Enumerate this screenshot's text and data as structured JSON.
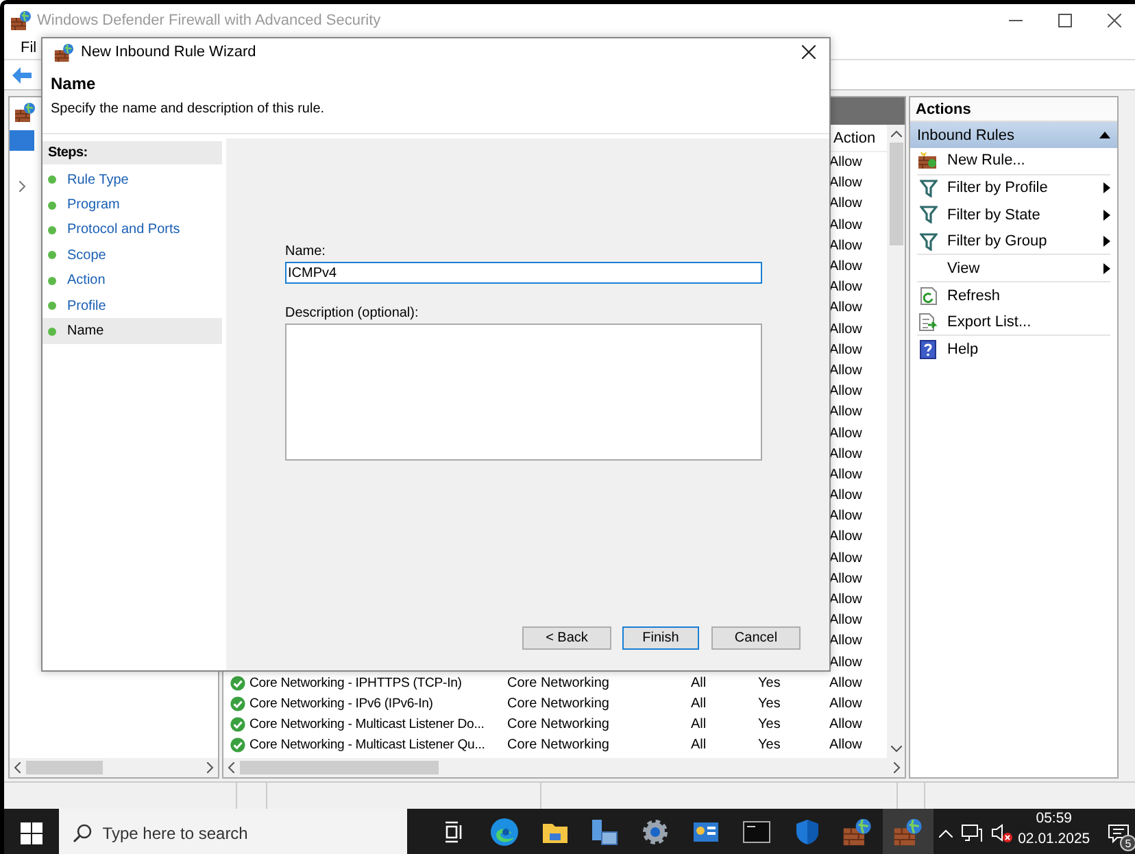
{
  "main_window": {
    "title": "Windows Defender Firewall with Advanced Security",
    "menu": [
      "Fil"
    ]
  },
  "rules": {
    "columns": [
      {
        "label": "Action"
      }
    ],
    "rows": [
      {
        "action": "Allow"
      },
      {
        "action": "Allow"
      },
      {
        "action": "Allow"
      },
      {
        "action": "Allow"
      },
      {
        "action": "Allow"
      },
      {
        "action": "Allow"
      },
      {
        "action": "Allow"
      },
      {
        "action": "Allow"
      },
      {
        "action": "Allow"
      },
      {
        "action": "Allow"
      },
      {
        "action": "Allow"
      },
      {
        "action": "Allow"
      },
      {
        "action": "Allow"
      },
      {
        "action": "Allow"
      },
      {
        "action": "Allow"
      },
      {
        "action": "Allow"
      },
      {
        "action": "Allow"
      },
      {
        "action": "Allow"
      },
      {
        "action": "Allow"
      },
      {
        "action": "Allow"
      },
      {
        "action": "Allow"
      },
      {
        "action": "Allow"
      },
      {
        "action": "Allow"
      },
      {
        "action": "Allow"
      },
      {
        "action": "Allow"
      },
      {
        "name": "Core Networking - IPHTTPS (TCP-In)",
        "group": "Core Networking",
        "profile": "All",
        "enabled": "Yes",
        "action": "Allow"
      },
      {
        "name": "Core Networking - IPv6 (IPv6-In)",
        "group": "Core Networking",
        "profile": "All",
        "enabled": "Yes",
        "action": "Allow"
      },
      {
        "name": "Core Networking - Multicast Listener Do...",
        "group": "Core Networking",
        "profile": "All",
        "enabled": "Yes",
        "action": "Allow"
      },
      {
        "name": "Core Networking - Multicast Listener Qu...",
        "group": "Core Networking",
        "profile": "All",
        "enabled": "Yes",
        "action": "Allow"
      }
    ]
  },
  "actions_pane": {
    "title": "Actions",
    "section": {
      "label": "Inbound Rules",
      "expanded": true
    },
    "items": [
      {
        "label": "New Rule...",
        "kind": "new_rule",
        "submenu": false,
        "separator": true
      },
      {
        "label": "Filter by Profile",
        "kind": "filter",
        "submenu": true,
        "separator": false
      },
      {
        "label": "Filter by State",
        "kind": "filter",
        "submenu": true,
        "separator": false
      },
      {
        "label": "Filter by Group",
        "kind": "filter",
        "submenu": true,
        "separator": true
      },
      {
        "label": "View",
        "kind": "none",
        "submenu": true,
        "separator": true
      },
      {
        "label": "Refresh",
        "kind": "refresh",
        "submenu": false,
        "separator": false
      },
      {
        "label": "Export List...",
        "kind": "export",
        "submenu": false,
        "separator": true
      },
      {
        "label": "Help",
        "kind": "help",
        "submenu": false,
        "separator": false
      }
    ]
  },
  "wizard": {
    "title": "New Inbound Rule Wizard",
    "heading": "Name",
    "subtitle": "Specify the name and description of this rule.",
    "steps_title": "Steps:",
    "steps": [
      {
        "label": "Rule Type",
        "selected": false
      },
      {
        "label": "Program",
        "selected": false
      },
      {
        "label": "Protocol and Ports",
        "selected": false
      },
      {
        "label": "Scope",
        "selected": false
      },
      {
        "label": "Action",
        "selected": false
      },
      {
        "label": "Profile",
        "selected": false
      },
      {
        "label": "Name",
        "selected": true
      }
    ],
    "name_label": "Name:",
    "name_value": "ICMPv4",
    "description_label": "Description (optional):",
    "buttons": [
      {
        "label": "< Back",
        "default": false
      },
      {
        "label": "Finish",
        "default": true
      },
      {
        "label": "Cancel",
        "default": false
      }
    ]
  },
  "taskbar": {
    "search_placeholder": "Type here to search",
    "apps": [
      {
        "kind": "task_view",
        "active": false
      },
      {
        "kind": "edge",
        "active": false
      },
      {
        "kind": "explorer",
        "active": false
      },
      {
        "kind": "server",
        "active": false
      },
      {
        "kind": "settings",
        "active": false
      },
      {
        "kind": "panel",
        "active": false
      },
      {
        "kind": "terminal",
        "active": false
      },
      {
        "kind": "shield",
        "active": false
      },
      {
        "kind": "firewall",
        "active": false
      },
      {
        "kind": "firewall",
        "active": true
      }
    ],
    "time": "05:59",
    "date": "02.01.2025",
    "notification_count": "5"
  }
}
